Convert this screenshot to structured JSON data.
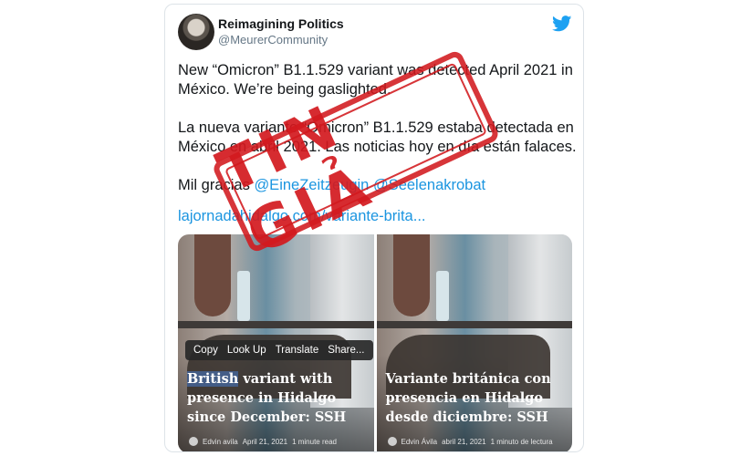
{
  "tweet": {
    "display_name": "Reimagining Politics",
    "handle": "@MeurerCommunity",
    "paragraph_1": "New “Omicron” B1.1.529 variant was detected April 2021 in México. We’re being gaslighted.",
    "paragraph_2": "La nueva variante “Omicron” B1.1.529 estaba detectada en México en abril 2021. Las noticias hoy en día están falaces.",
    "thanks_prefix": "Mil gracias ",
    "mention_1": "@EineZeitzeugin",
    "mention_2": "@Seelenakrobat",
    "link": "lajornadahidalgo.com/variante-brita..."
  },
  "media": {
    "left": {
      "context_menu": [
        "Copy",
        "Look Up",
        "Translate",
        "Share..."
      ],
      "headline_highlight": "British",
      "headline_rest": " variant with presence in Hidalgo since December: SSH",
      "author": "Edvin avila",
      "date": "April 21, 2021",
      "read_time": "1 minute read"
    },
    "right": {
      "headline": "Variante británica con presencia en Hidalgo desde diciembre: SSH",
      "author": "Edvin Ávila",
      "date": "abril 21, 2021",
      "read_time": "1 minuto de lectura"
    }
  },
  "stamp": {
    "text": "TIN GIẢ"
  },
  "colors": {
    "link": "#1b95e0",
    "stamp": "#d2191e",
    "twitter_blue": "#1da1f2"
  },
  "icons": {
    "brand": "twitter-bird-icon"
  }
}
